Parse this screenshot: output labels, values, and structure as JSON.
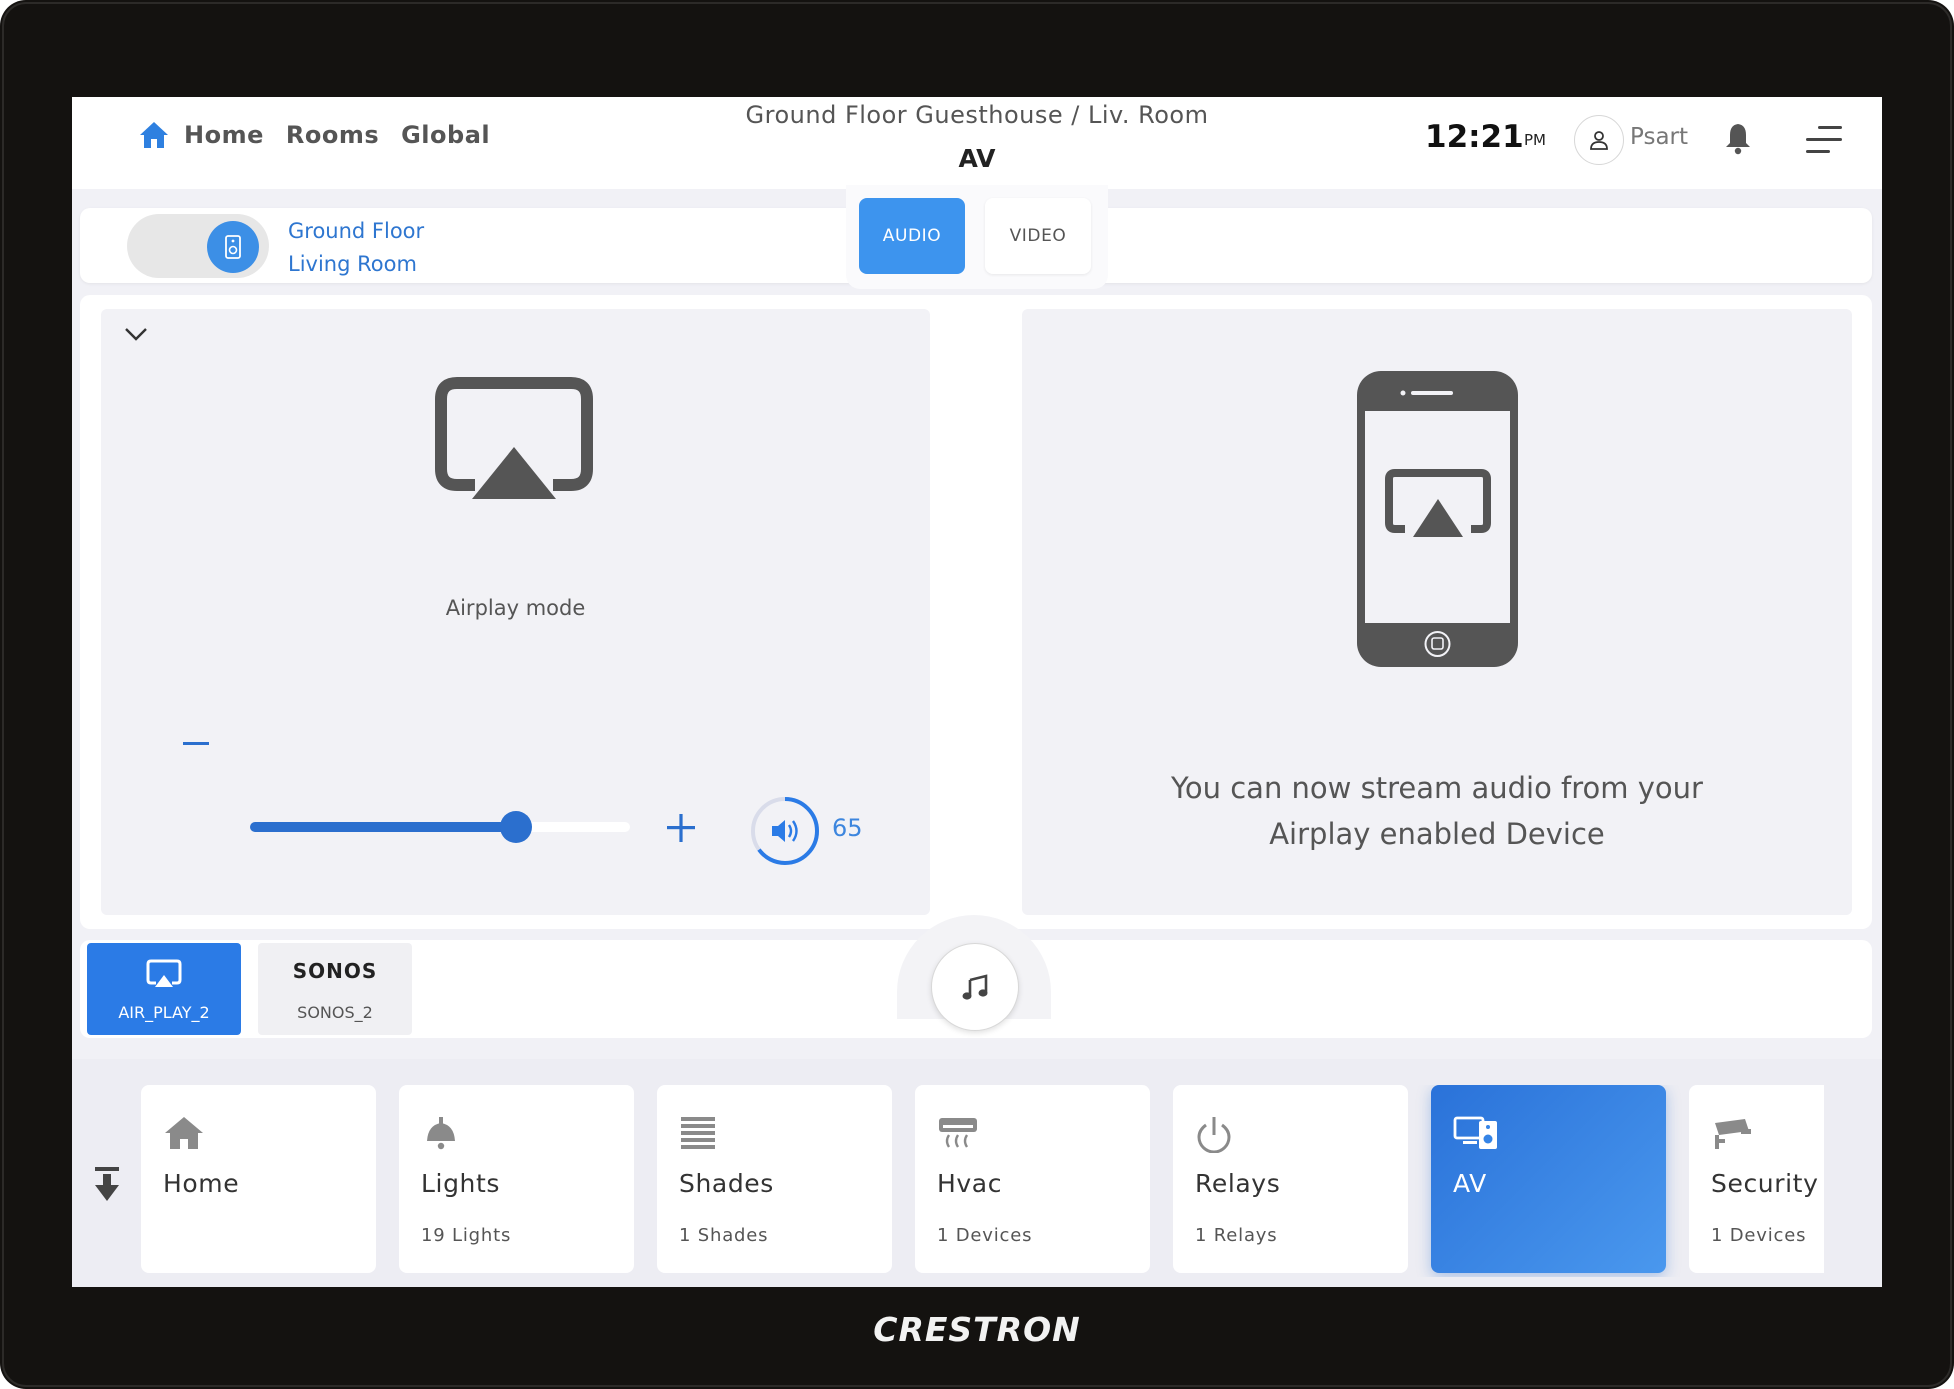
{
  "device": {
    "brand": "CRESTRON"
  },
  "header": {
    "nav": {
      "home": "Home",
      "rooms": "Rooms",
      "global": "Global"
    },
    "location": "Ground Floor Guesthouse / Liv. Room",
    "title": "AV",
    "time": "12:21",
    "ampm": "PM",
    "user": "Psart"
  },
  "room": {
    "line1": "Ground Floor",
    "line2": "Living Room",
    "power_on": true
  },
  "tabs": {
    "audio": "AUDIO",
    "video": "VIDEO",
    "active": "audio"
  },
  "player": {
    "mode_label": "Airplay mode",
    "volume": 65,
    "volume_display": "65",
    "volume_fraction": 0.7,
    "stream_line1": "You can now stream audio from your",
    "stream_line2": "Airplay enabled Device"
  },
  "sources": [
    {
      "label": "AIR_PLAY_2",
      "icon": "airplay-icon",
      "active": true
    },
    {
      "label": "SONOS_2",
      "logo": "SONOS",
      "active": false
    }
  ],
  "tiles": [
    {
      "name": "Home",
      "count": "",
      "icon": "home-icon"
    },
    {
      "name": "Lights",
      "count": "19 Lights",
      "icon": "lamp-icon"
    },
    {
      "name": "Shades",
      "count": "1 Shades",
      "icon": "shades-icon"
    },
    {
      "name": "Hvac",
      "count": "1 Devices",
      "icon": "hvac-icon"
    },
    {
      "name": "Relays",
      "count": "1 Relays",
      "icon": "power-icon"
    },
    {
      "name": "AV",
      "count": "",
      "icon": "av-icon",
      "active": true
    },
    {
      "name": "Security",
      "count": "1 Devices",
      "icon": "camera-icon"
    }
  ],
  "colors": {
    "accent": "#2b7be6",
    "accent_dark": "#2b6fce",
    "text": "#555555",
    "panel": "#f2f2f6"
  }
}
